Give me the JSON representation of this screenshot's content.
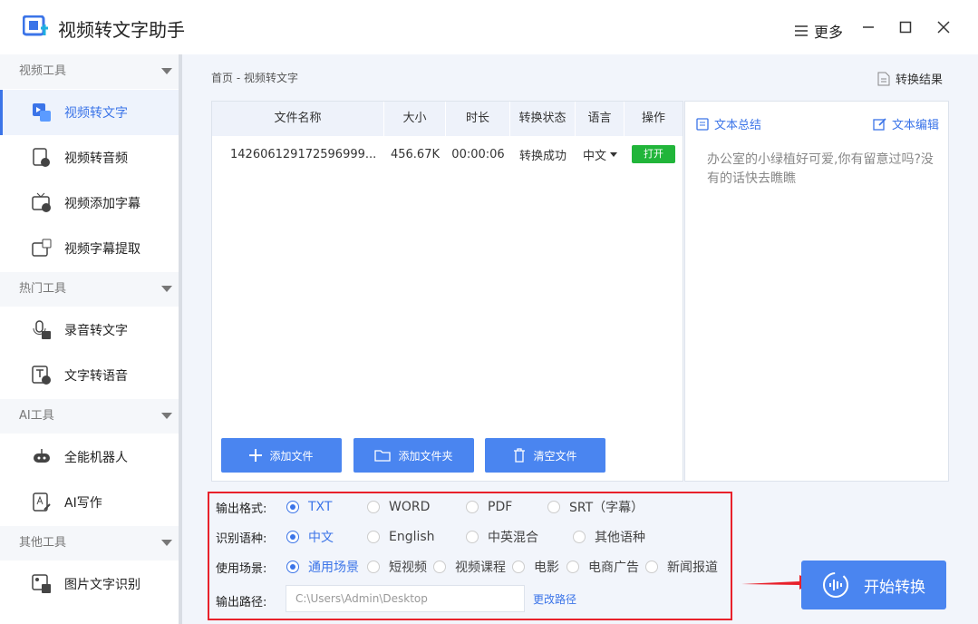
{
  "window": {
    "title": "视频转文字助手",
    "more_label": "更多"
  },
  "sidebar": {
    "groups": [
      {
        "label": "视频工具",
        "items": [
          "视频转文字",
          "视频转音频",
          "视频添加字幕",
          "视频字幕提取"
        ]
      },
      {
        "label": "热门工具",
        "items": [
          "录音转文字",
          "文字转语音"
        ]
      },
      {
        "label": "AI工具",
        "items": [
          "全能机器人",
          "AI写作"
        ]
      },
      {
        "label": "其他工具",
        "items": [
          "图片文字识别"
        ]
      }
    ],
    "active": "视频转文字"
  },
  "breadcrumb": {
    "home": "首页",
    "separator": "-",
    "current": "视频转文字"
  },
  "result_link": "转换结果",
  "table": {
    "headers": [
      "文件名称",
      "大小",
      "时长",
      "转换状态",
      "语言",
      "操作"
    ],
    "rows": [
      {
        "name": "142606129172596999...",
        "size": "456.67K",
        "duration": "00:00:06",
        "status": "转换成功",
        "language": "中文",
        "action": "打开"
      }
    ]
  },
  "buttons": {
    "add_file": "添加文件",
    "add_folder": "添加文件夹",
    "clear": "清空文件",
    "start": "开始转换"
  },
  "summary": {
    "title": "文本总结",
    "edit": "文本编辑",
    "text": "办公室的小绿植好可爱,你有留意过吗?没有的话快去瞧瞧"
  },
  "options": {
    "format": {
      "label": "输出格式:",
      "choices": [
        "TXT",
        "WORD",
        "PDF",
        "SRT（字幕）"
      ],
      "selected": "TXT"
    },
    "language": {
      "label": "识别语种:",
      "choices": [
        "中文",
        "English",
        "中英混合",
        "其他语种"
      ],
      "selected": "中文"
    },
    "scene": {
      "label": "使用场景:",
      "choices": [
        "通用场景",
        "短视频",
        "视频课程",
        "电影",
        "电商广告",
        "新闻报道"
      ],
      "selected": "通用场景"
    },
    "path": {
      "label": "输出路径:",
      "value": "C:\\Users\\Admin\\Desktop",
      "change": "更改路径"
    }
  },
  "colors": {
    "accent": "#4a85f0",
    "success": "#21b53a",
    "highlight_border": "#e8212b"
  }
}
